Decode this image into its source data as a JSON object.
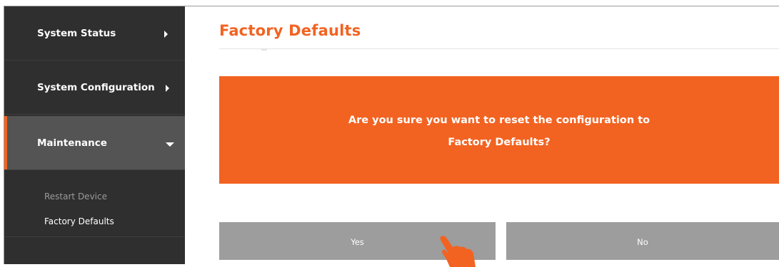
{
  "sidebar": {
    "items": [
      {
        "label": "System Status"
      },
      {
        "label": "System Configuration"
      },
      {
        "label": "Maintenance"
      }
    ],
    "submenu": [
      {
        "label": "Restart Device"
      },
      {
        "label": "Factory Defaults"
      }
    ]
  },
  "main": {
    "title": "Factory Defaults",
    "message_line1": "Are you sure you want to reset the configuration to",
    "message_line2": "Factory Defaults?",
    "yes_label": "Yes",
    "no_label": "No"
  },
  "colors": {
    "accent": "#f26322",
    "sidebar_bg": "#2f2f2f",
    "sidebar_active_bg": "#545454",
    "button_bg": "#9d9d9d"
  },
  "icons": {
    "nav_expand": "triangle-right-icon",
    "nav_collapse": "triangle-down-icon",
    "pointer": "hand-pointer-icon"
  }
}
